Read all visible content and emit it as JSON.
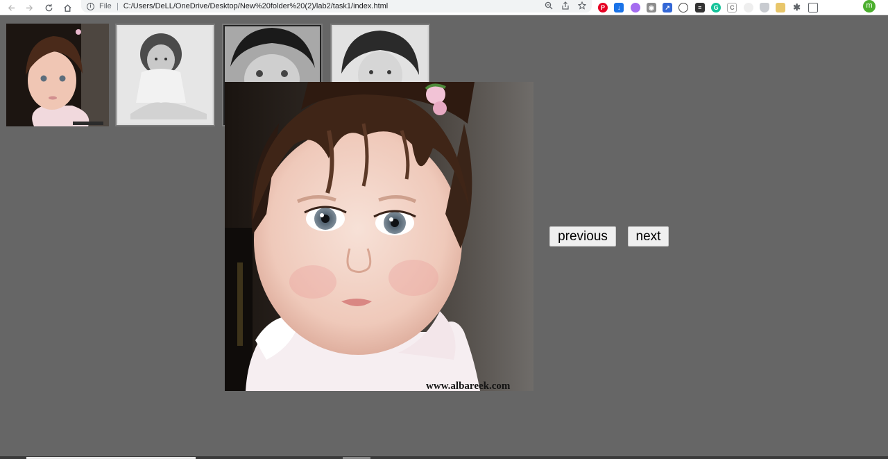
{
  "browser": {
    "scheme_label": "File",
    "url": "C:/Users/DeLL/OneDrive/Desktop/New%20folder%20(2)/lab2/task1/index.html",
    "avatar_letter": "m",
    "accent": "#4caf2f"
  },
  "gallery": {
    "thumbnails": [
      {
        "name": "thumbnail-baby-color",
        "tone": "color"
      },
      {
        "name": "thumbnail-baby-sitting",
        "tone": "grayscale"
      },
      {
        "name": "thumbnail-baby-curly",
        "tone": "grayscale"
      },
      {
        "name": "thumbnail-baby-smile",
        "tone": "grayscale"
      }
    ],
    "main_image": {
      "watermark": "www.albareek.com"
    }
  },
  "controls": {
    "previous_label": "previous",
    "next_label": "next"
  },
  "colors": {
    "page_background": "#666666",
    "button_background": "#efefef"
  }
}
